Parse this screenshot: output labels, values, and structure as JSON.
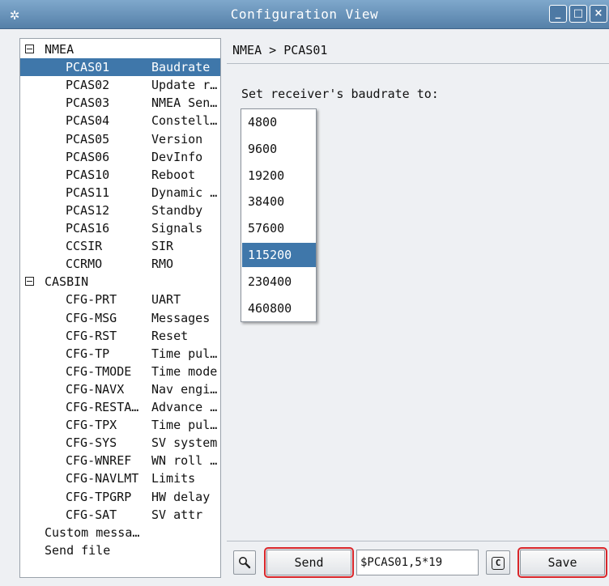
{
  "window": {
    "title": "Configuration View",
    "menu_icon": "asterisk-menu-icon",
    "minimize_label": "_",
    "maximize_label": "□",
    "close_label": "×"
  },
  "tree": {
    "groups": [
      {
        "label": "NMEA",
        "expander": "⊟"
      },
      {
        "label": "CASBIN",
        "expander": "⊟"
      }
    ],
    "nmea_items": [
      {
        "cmd": "PCAS01",
        "desc": "Baudrate",
        "selected": true
      },
      {
        "cmd": "PCAS02",
        "desc": "Update r…"
      },
      {
        "cmd": "PCAS03",
        "desc": "NMEA Sen…"
      },
      {
        "cmd": "PCAS04",
        "desc": "Constell…"
      },
      {
        "cmd": "PCAS05",
        "desc": "Version"
      },
      {
        "cmd": "PCAS06",
        "desc": "DevInfo"
      },
      {
        "cmd": "PCAS10",
        "desc": "Reboot"
      },
      {
        "cmd": "PCAS11",
        "desc": "Dynamic …"
      },
      {
        "cmd": "PCAS12",
        "desc": "Standby"
      },
      {
        "cmd": "PCAS16",
        "desc": "Signals"
      },
      {
        "cmd": "CCSIR",
        "desc": "SIR"
      },
      {
        "cmd": "CCRMO",
        "desc": "RMO"
      }
    ],
    "casbin_items": [
      {
        "cmd": "CFG-PRT",
        "desc": "UART"
      },
      {
        "cmd": "CFG-MSG",
        "desc": "Messages"
      },
      {
        "cmd": "CFG-RST",
        "desc": "Reset"
      },
      {
        "cmd": "CFG-TP",
        "desc": "Time pul…"
      },
      {
        "cmd": "CFG-TMODE",
        "desc": "Time mode"
      },
      {
        "cmd": "CFG-NAVX",
        "desc": "Nav engi…"
      },
      {
        "cmd": "CFG-RESTA…",
        "desc": "Advance …"
      },
      {
        "cmd": "CFG-TPX",
        "desc": "Time pul…"
      },
      {
        "cmd": "CFG-SYS",
        "desc": "SV system"
      },
      {
        "cmd": "CFG-WNREF",
        "desc": "WN roll …"
      },
      {
        "cmd": "CFG-NAVLMT",
        "desc": "Limits"
      },
      {
        "cmd": "CFG-TPGRP",
        "desc": "HW delay"
      },
      {
        "cmd": "CFG-SAT",
        "desc": "SV attr"
      }
    ],
    "extra_items": [
      "Custom messa…",
      "Send file"
    ]
  },
  "main": {
    "breadcrumb": "NMEA > PCAS01",
    "prompt": "Set receiver's baudrate to:",
    "baudrate_options": [
      "4800",
      "9600",
      "19200",
      "38400",
      "57600",
      "115200",
      "230400",
      "460800"
    ],
    "selected_baudrate": "115200"
  },
  "footer": {
    "search_icon": "magnifier-icon",
    "send_label": "Send",
    "command_value": "$PCAS01,5*19",
    "copy_icon_label": "C",
    "save_label": "Save"
  },
  "colors": {
    "titlebar": "#5e88b0",
    "selection": "#3f77aa",
    "highlight_outline": "#d9262a"
  }
}
